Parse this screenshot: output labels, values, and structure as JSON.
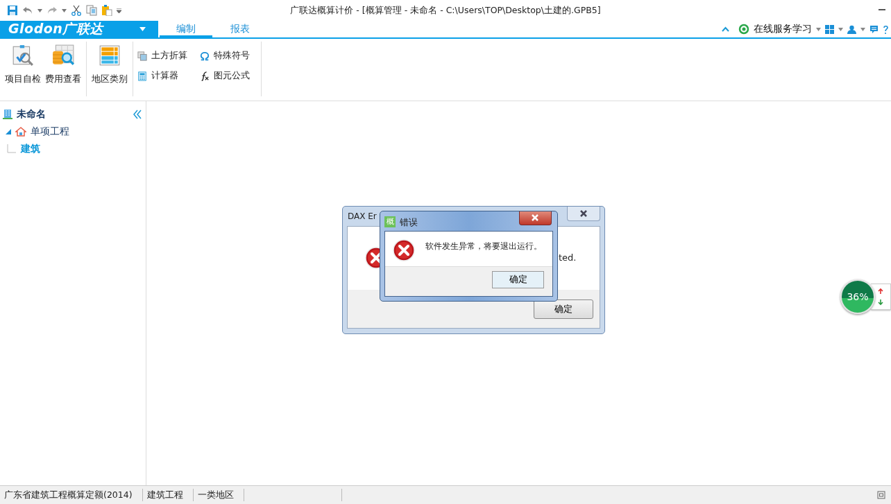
{
  "window": {
    "title": "广联达概算计价 - [概算管理 - 未命名 - C:\\Users\\TOP\\Desktop\\土建的.GPB5]"
  },
  "logo": {
    "text": "Glodon广联达"
  },
  "tabs": [
    {
      "label": "编制",
      "selected": true
    },
    {
      "label": "报表",
      "selected": false
    }
  ],
  "service": {
    "label": "在线服务学习"
  },
  "ribbon": {
    "groups": [
      {
        "kind": "large",
        "items": [
          "项目自检",
          "费用查看"
        ]
      },
      {
        "kind": "large",
        "items": [
          "地区类别"
        ]
      },
      {
        "kind": "small",
        "items": [
          "土方折算",
          "特殊符号",
          "计算器",
          "图元公式"
        ]
      }
    ]
  },
  "tree": {
    "label": "未命名",
    "selected": false,
    "children": [
      {
        "label": "单项工程",
        "expanded": true,
        "selected": false,
        "children": [
          {
            "label": "建筑",
            "selected": true
          }
        ]
      }
    ]
  },
  "back_dialog": {
    "title": "DAX Er",
    "message": "ted.",
    "button": "确定"
  },
  "front_dialog": {
    "app_icon": "概",
    "title": "错误",
    "message": "软件发生异常，将要退出运行。",
    "button": "确定"
  },
  "meter": {
    "reading": "36%"
  },
  "status_bar": [
    "广东省建筑工程概算定额(2014)",
    "建筑工程",
    "一类地区"
  ]
}
